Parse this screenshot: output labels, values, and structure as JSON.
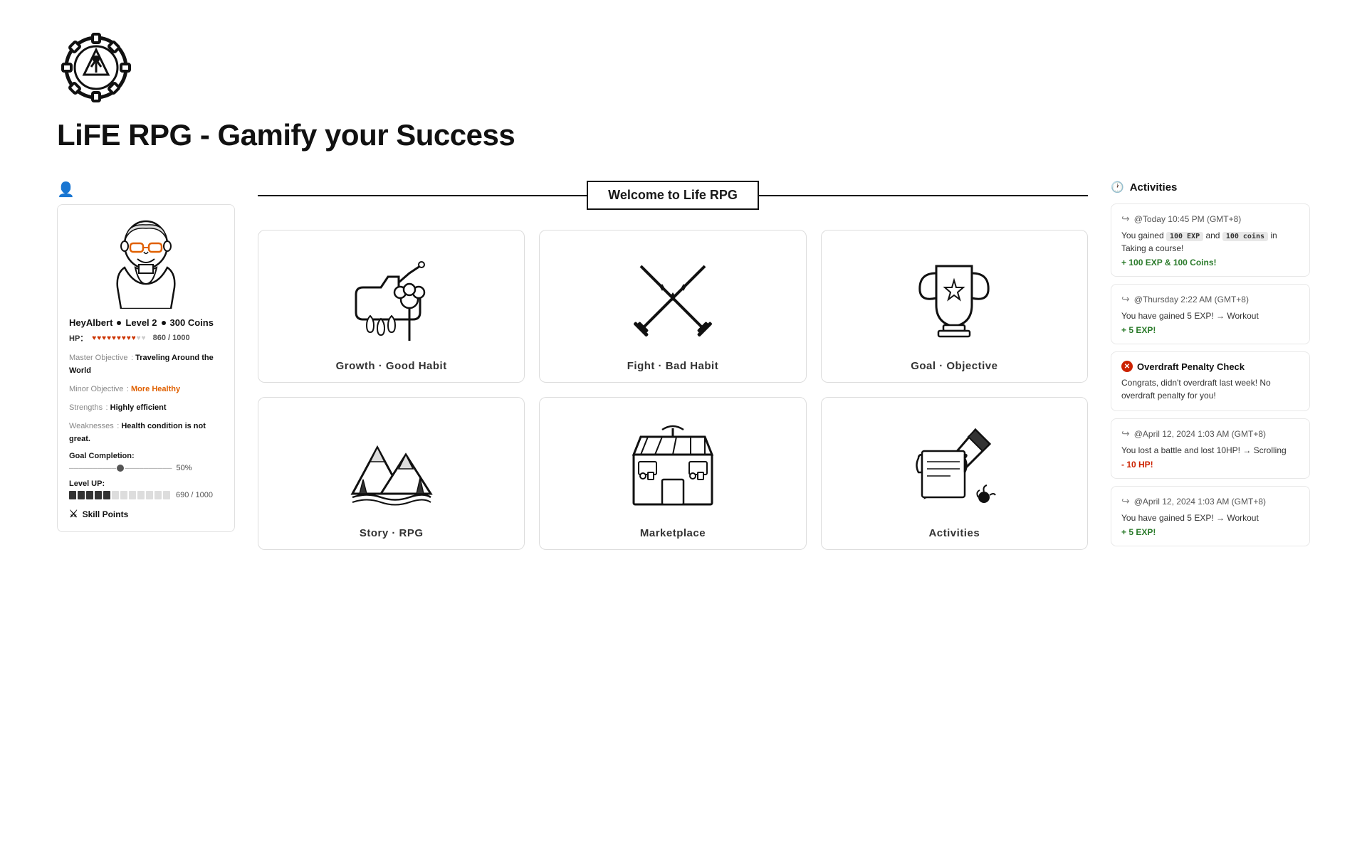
{
  "app": {
    "title": "LiFE RPG - Gamify your Success"
  },
  "character": {
    "name": "HeyAlbert",
    "level": "Level 2",
    "coins": "300 Coins",
    "hp_current": 860,
    "hp_max": 1000,
    "hp_filled": 9,
    "hp_empty": 2,
    "master_objective_label": "Master Objective",
    "master_objective_value": "Traveling Around the World",
    "minor_objective_label": "Minor Objective",
    "minor_objective_value": "More Healthy",
    "strengths_label": "Strengths",
    "strengths_value": "Highly efficient",
    "weaknesses_label": "Weaknesses",
    "weaknesses_value": "Health condition is not great.",
    "goal_completion_label": "Goal Completion:",
    "goal_completion_pct": "50%",
    "level_up_label": "Level UP:",
    "level_xp_current": 690,
    "level_xp_max": 1000,
    "level_xp_text": "690 / 1000",
    "skill_points_label": "Skill Points"
  },
  "welcome": {
    "banner": "Welcome to Life RPG"
  },
  "grid_cards": [
    {
      "id": "growth-good-habit",
      "label": "Growth · Good Habit"
    },
    {
      "id": "fight-bad-habit",
      "label": "Fight · Bad Habit"
    },
    {
      "id": "goal-objective",
      "label": "Goal · Objective"
    },
    {
      "id": "story-rpg",
      "label": "Story · RPG"
    },
    {
      "id": "marketplace",
      "label": "Marketplace"
    },
    {
      "id": "activities",
      "label": "Activities"
    }
  ],
  "activities_panel": {
    "title": "Activities",
    "entries": [
      {
        "id": "act1",
        "timestamp": "@Today 10:45 PM (GMT+8)",
        "body": "You gained",
        "tag1": "100 EXP",
        "mid": "and",
        "tag2": "100 coins",
        "end": "in Taking a course!",
        "reward": "+ 100 EXP & 100 Coins!",
        "reward_type": "positive"
      },
      {
        "id": "act2",
        "timestamp": "@Thursday 2:22 AM (GMT+8)",
        "body": "You have gained 5 EXP! → Workout",
        "reward": "+ 5 EXP!",
        "reward_type": "positive"
      },
      {
        "id": "act3",
        "timestamp": "@April 12, 2024 1:03 AM (GMT+8)",
        "body": "You lost a battle and lost 10HP! → Scrolling",
        "reward": "- 10 HP!",
        "reward_type": "negative"
      },
      {
        "id": "act4",
        "timestamp": "@April 12, 2024 1:03 AM (GMT+8)",
        "body": "You have gained 5 EXP! → Workout",
        "reward": "+ 5 EXP!",
        "reward_type": "positive"
      }
    ],
    "overdraft": {
      "title": "Overdraft Penalty Check",
      "body": "Congrats, didn't overdraft last week! No overdraft penalty for you!"
    }
  }
}
